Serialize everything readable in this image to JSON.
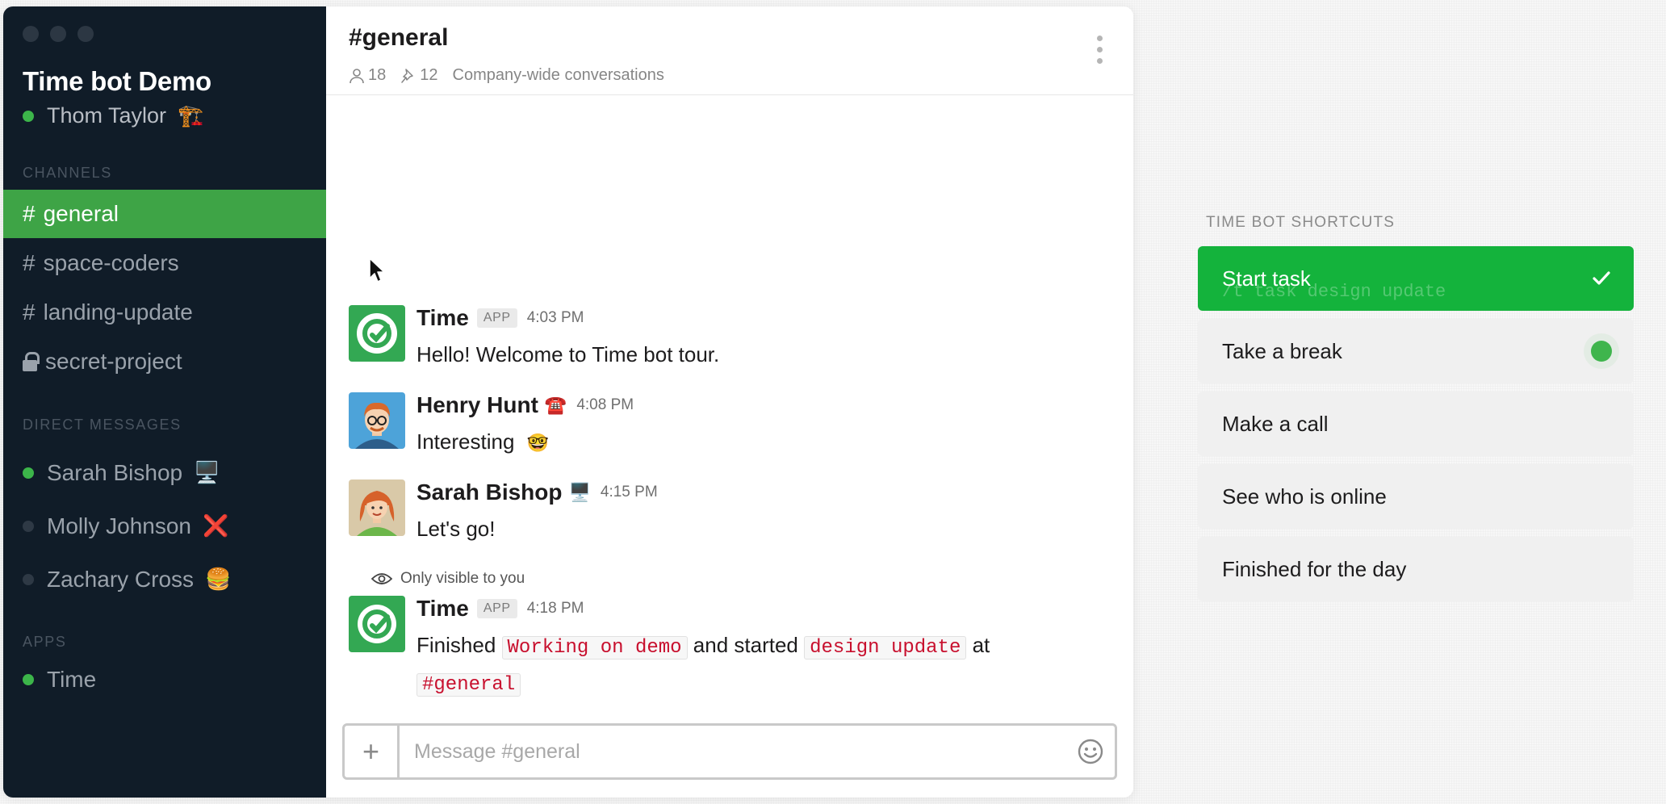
{
  "sidebar": {
    "workspace": "Time bot Demo",
    "current_user": {
      "name": "Thom Taylor",
      "status_emoji": "🏗️",
      "online": true
    },
    "channels_title": "CHANNELS",
    "channels": [
      {
        "prefix": "#",
        "label": "general",
        "active": true
      },
      {
        "prefix": "#",
        "label": "space-coders",
        "active": false
      },
      {
        "prefix": "#",
        "label": "landing-update",
        "active": false
      },
      {
        "prefix": "lock",
        "label": "secret-project",
        "active": false
      }
    ],
    "dm_title": "DIRECT MESSAGES",
    "dms": [
      {
        "name": "Sarah Bishop",
        "emoji": "🖥️",
        "online": true
      },
      {
        "name": "Molly Johnson",
        "emoji": "❌",
        "online": false
      },
      {
        "name": "Zachary Cross",
        "emoji": "🍔",
        "online": false
      }
    ],
    "apps_title": "APPS",
    "apps": [
      {
        "name": "Time",
        "online": true
      }
    ]
  },
  "channel": {
    "title": "#general",
    "members": "18",
    "pinned": "12",
    "description": "Company-wide conversations"
  },
  "messages": [
    {
      "sender": "Time",
      "badge": "APP",
      "time": "4:03 PM",
      "text": "Hello! Welcome to Time bot tour."
    },
    {
      "sender": "Henry Hunt",
      "status_emoji": "☎️",
      "time": "4:08 PM",
      "text": "Interesting",
      "text_emoji": "🤓"
    },
    {
      "sender": "Sarah Bishop",
      "status_emoji": "🖥️",
      "time": "4:15 PM",
      "text": "Let's go!"
    },
    {
      "visibility_note": "Only visible to you",
      "sender": "Time",
      "badge": "APP",
      "time": "4:18 PM",
      "text_parts": [
        "Finished",
        "Working on demo",
        "and started",
        "design update",
        "at",
        "#general"
      ]
    }
  ],
  "composer": {
    "placeholder": "Message #general",
    "plus": "+"
  },
  "shortcuts": {
    "title": "TIME BOT SHORTCUTS",
    "items": [
      {
        "label": "Start task",
        "active": true,
        "ghost": "/t task design update"
      },
      {
        "label": "Take a break",
        "active": false
      },
      {
        "label": "Make a call",
        "active": false
      },
      {
        "label": "See who is online",
        "active": false
      },
      {
        "label": "Finished for the day",
        "active": false
      }
    ]
  },
  "colors": {
    "sidebar_bg": "#101c28",
    "active_channel": "#3ea446",
    "shortcut_active": "#14b33c",
    "online": "#3cb54a",
    "code_text": "#c8102e"
  }
}
